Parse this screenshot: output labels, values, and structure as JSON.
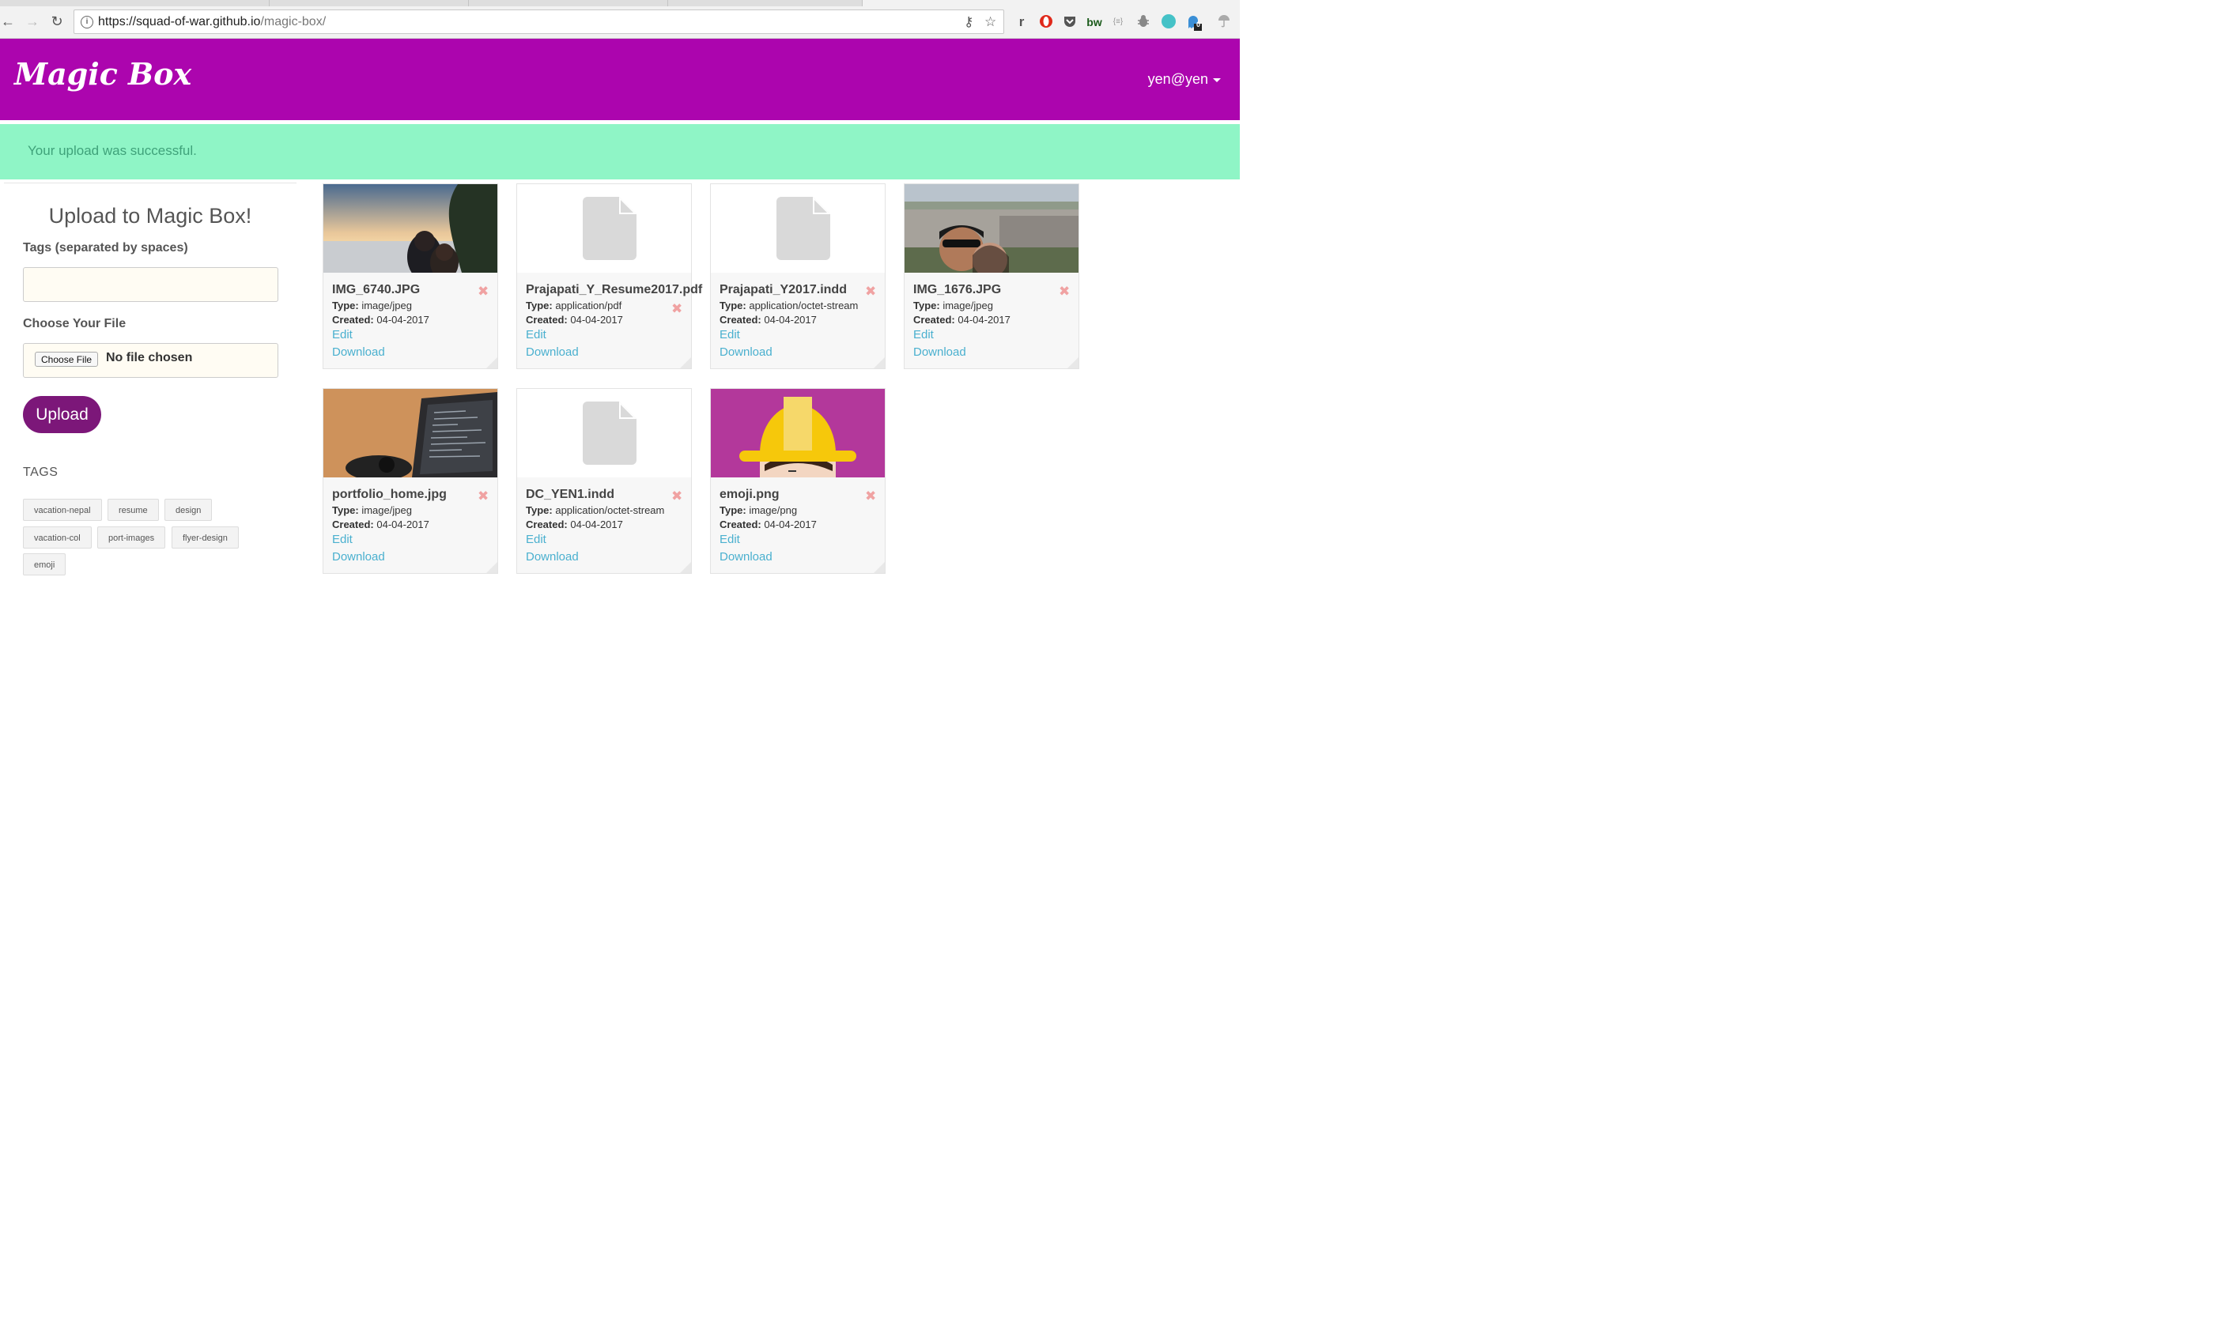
{
  "browser": {
    "url_host": "https://squad-of-war.github.io",
    "url_path": "/magic-box/",
    "extensions": [
      "r",
      "bw",
      "{≡}",
      "0"
    ]
  },
  "header": {
    "logo": "Magic Box",
    "user": "yen@yen"
  },
  "alert": {
    "message": "Your upload was successful."
  },
  "sidebar": {
    "title": "Upload to Magic Box!",
    "tags_label": "Tags (separated by spaces)",
    "tags_value": "",
    "file_label": "Choose Your File",
    "choose_button": "Choose File",
    "file_status": "No file chosen",
    "upload_button": "Upload",
    "tags_heading": "TAGS",
    "tags": [
      "vacation-nepal",
      "resume",
      "design",
      "vacation-col",
      "port-images",
      "flyer-design",
      "emoji"
    ]
  },
  "labels": {
    "type": "Type:",
    "created": "Created:",
    "edit": "Edit",
    "download": "Download",
    "delete": "✖"
  },
  "files": [
    {
      "name": "IMG_6740.JPG",
      "type": "image/jpeg",
      "created": "04-04-2017",
      "thumb": "sunset-photo"
    },
    {
      "name": "Prajapati_Y_Resume2017.pdf",
      "type": "application/pdf",
      "created": "04-04-2017",
      "thumb": "document-icon"
    },
    {
      "name": "Prajapati_Y2017.indd",
      "type": "application/octet-stream",
      "created": "04-04-2017",
      "thumb": "document-icon"
    },
    {
      "name": "IMG_1676.JPG",
      "type": "image/jpeg",
      "created": "04-04-2017",
      "thumb": "city-photo"
    },
    {
      "name": "portfolio_home.jpg",
      "type": "image/jpeg",
      "created": "04-04-2017",
      "thumb": "laptop-photo"
    },
    {
      "name": "DC_YEN1.indd",
      "type": "application/octet-stream",
      "created": "04-04-2017",
      "thumb": "document-icon"
    },
    {
      "name": "emoji.png",
      "type": "image/png",
      "created": "04-04-2017",
      "thumb": "emoji-image"
    }
  ],
  "colors": {
    "header": "#ac05ae",
    "alert": "#8ff5c6",
    "upload_button": "#7c1779",
    "link": "#4ab0cf",
    "delete": "#f0a2a2"
  }
}
